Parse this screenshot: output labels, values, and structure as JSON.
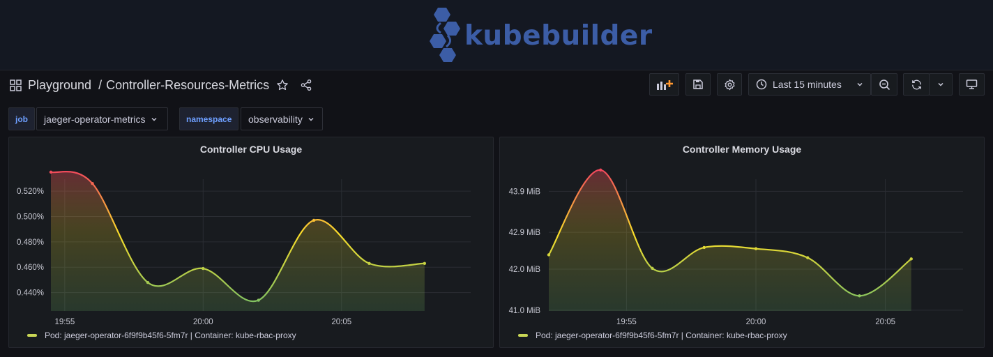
{
  "banner": {
    "logo_text": "kubebuilder"
  },
  "breadcrumb": {
    "folder": "Playground",
    "separator": "/",
    "dashboard": "Controller-Resources-Metrics"
  },
  "toolbar": {
    "add_panel_icon": "add-panel-icon",
    "save_icon": "save-icon",
    "settings_icon": "gear-icon",
    "time_range": "Last 15 minutes",
    "zoom_out_icon": "zoom-out-icon",
    "refresh_icon": "refresh-icon",
    "tv_mode_icon": "monitor-icon"
  },
  "variables": [
    {
      "label": "job",
      "value": "jaeger-operator-metrics"
    },
    {
      "label": "namespace",
      "value": "observability"
    }
  ],
  "colors": {
    "background": "#111217",
    "panel": "#181b1f",
    "series_line_low": "#73bf69",
    "series_line_mid": "#fade2a",
    "series_line_high": "#f2495c",
    "legend": "#c8d655",
    "var_label": "#6e9fff"
  },
  "panels": [
    {
      "title": "Controller CPU Usage",
      "legend": "Pod: jaeger-operator-6f9f9b45f6-5fm7r | Container: kube-rbac-proxy"
    },
    {
      "title": "Controller Memory Usage",
      "legend": "Pod: jaeger-operator-6f9f9b45f6-5fm7r | Container: kube-rbac-proxy"
    }
  ],
  "chart_data": [
    {
      "type": "line",
      "title": "Controller CPU Usage",
      "y_unit": "%",
      "x_ticks": [
        "19:55",
        "20:00",
        "20:05"
      ],
      "y_ticks": [
        "0.440%",
        "0.460%",
        "0.480%",
        "0.500%",
        "0.520%"
      ],
      "ylim": [
        0.4255,
        0.536
      ],
      "xlim": [
        "19:54:30",
        "20:09:40"
      ],
      "grid": true,
      "series": [
        {
          "name": "Pod: jaeger-operator-6f9f9b45f6-5fm7r | Container: kube-rbac-proxy",
          "x": [
            "19:54:30",
            "19:56:00",
            "19:58:00",
            "20:00:00",
            "20:02:00",
            "20:04:00",
            "20:06:00",
            "20:08:00"
          ],
          "y": [
            0.535,
            0.526,
            0.448,
            0.459,
            0.434,
            0.497,
            0.463,
            0.463
          ]
        }
      ]
    },
    {
      "type": "line",
      "title": "Controller Memory Usage",
      "y_unit": "MiB",
      "x_ticks": [
        "19:55",
        "20:00",
        "20:05"
      ],
      "y_ticks": [
        "41.0 MiB",
        "42.0 MiB",
        "42.9 MiB",
        "43.9 MiB"
      ],
      "ylim": [
        40.98,
        44.4
      ],
      "xlim": [
        "19:52:00",
        "20:08:00"
      ],
      "grid": true,
      "series": [
        {
          "name": "Pod: jaeger-operator-6f9f9b45f6-5fm7r | Container: kube-rbac-proxy",
          "x": [
            "19:52:00",
            "19:54:00",
            "19:56:00",
            "19:58:00",
            "20:00:00",
            "20:02:00",
            "20:04:00",
            "20:06:00"
          ],
          "y": [
            42.35,
            44.42,
            42.02,
            42.53,
            42.5,
            42.28,
            41.35,
            42.25
          ]
        }
      ]
    }
  ]
}
